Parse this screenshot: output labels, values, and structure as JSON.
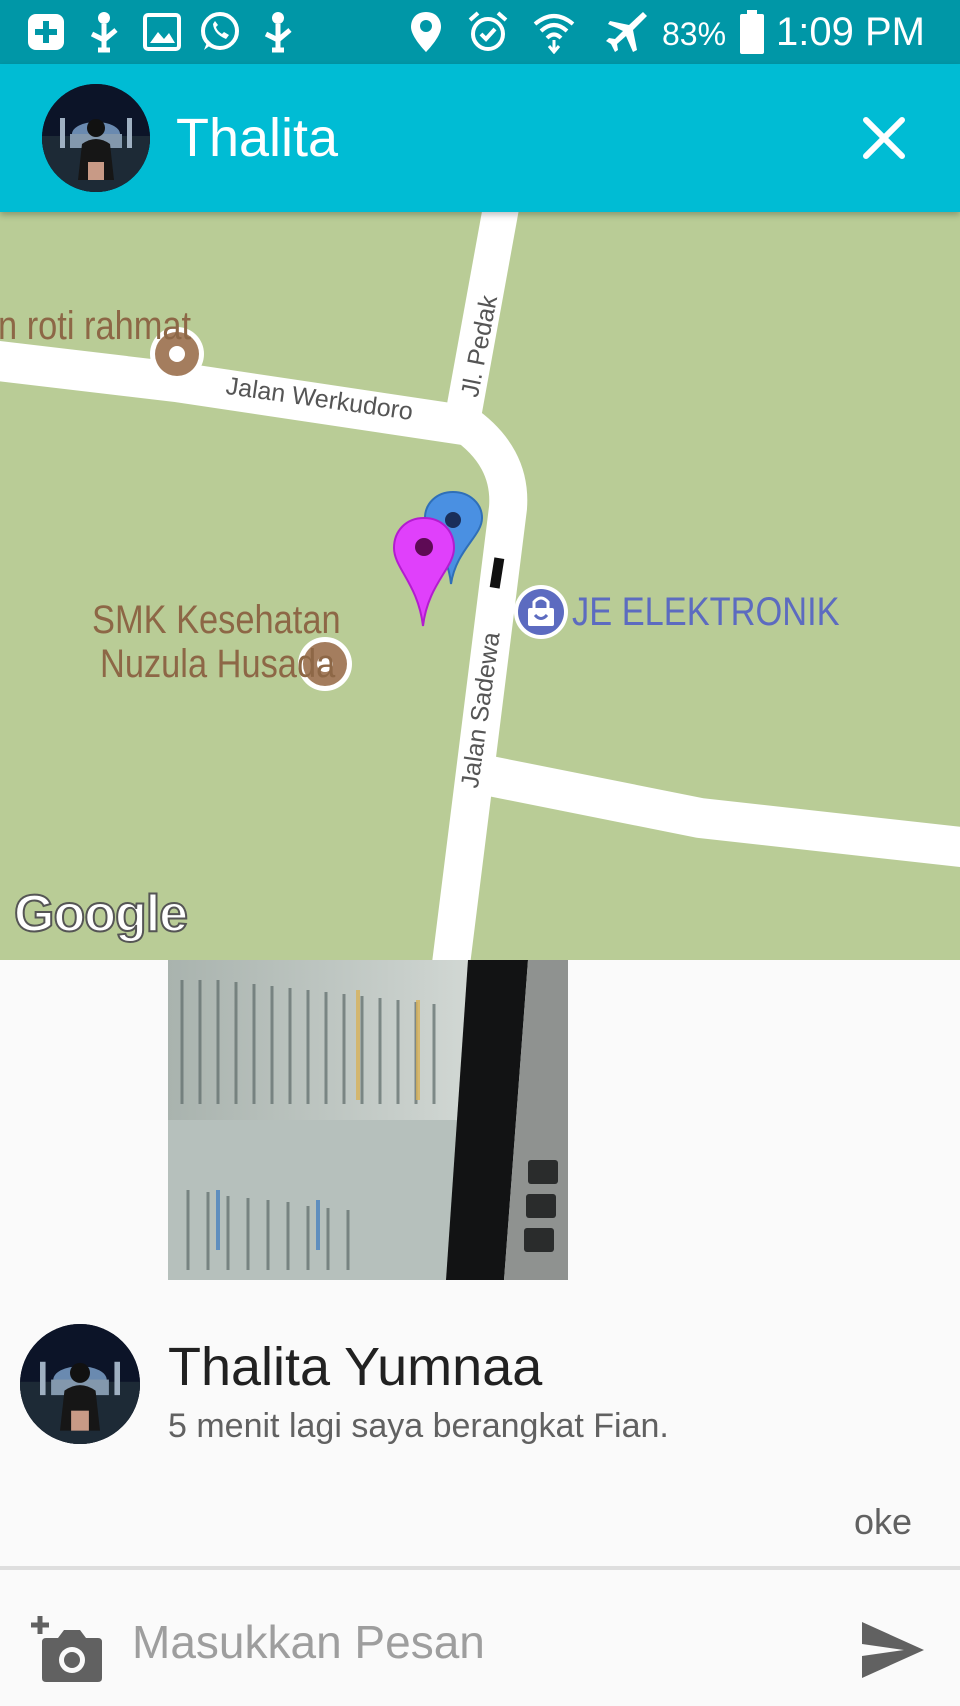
{
  "status_bar": {
    "battery_percent": "83%",
    "time": "1:09 PM",
    "icons": [
      "add-box-icon",
      "usb-debug-icon",
      "image-icon",
      "whatsapp-icon",
      "usb-debug-icon",
      "location-icon",
      "alarm-icon",
      "wifi-icon",
      "airplane-mode-icon",
      "battery-icon"
    ]
  },
  "header": {
    "title": "Thalita",
    "close_icon": "close-icon"
  },
  "map": {
    "places": {
      "bakery": "n roti rahmat",
      "school_line1": "SMK Kesehatan",
      "school_line2": "Nuzula Husada",
      "shop": "JE ELEKTRONIK"
    },
    "streets": {
      "werkudoro": "Jalan Werkudoro",
      "pedak": "Jl. Pedak",
      "sadewa": "Jalan Sadewa"
    },
    "attribution": "Google",
    "marker_colors": {
      "blue": "#4a90e2",
      "magenta": "#e040fb"
    }
  },
  "chat": {
    "sender_name": "Thalita Yumnaa",
    "message": "5 menit lagi saya berangkat Fian.",
    "reply": "oke"
  },
  "composer": {
    "placeholder": "Masukkan Pesan",
    "value": "",
    "camera_icon": "add-photo-icon",
    "send_icon": "send-icon"
  },
  "colors": {
    "status_bar": "#0097a7",
    "app_bar": "#00bcd4",
    "map_land": "#b9cc96",
    "poi": "#8d6746",
    "shop": "#5c6bc0"
  }
}
